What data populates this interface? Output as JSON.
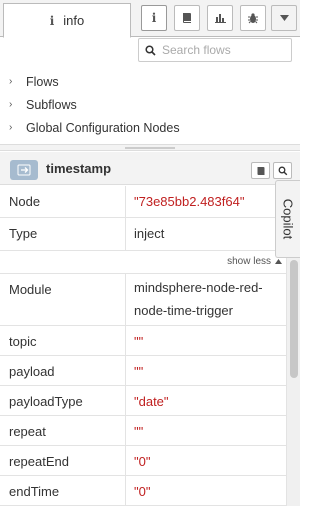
{
  "tabs": {
    "info_label": "info",
    "buttons": [
      "info-icon",
      "book-icon",
      "chart-icon",
      "bug-icon",
      "caret-down-icon"
    ]
  },
  "search": {
    "placeholder": "Search flows"
  },
  "tree": {
    "items": [
      {
        "label": "Flows"
      },
      {
        "label": "Subflows"
      },
      {
        "label": "Global Configuration Nodes"
      }
    ]
  },
  "node": {
    "title": "timestamp",
    "icon": "arrow-right-icon"
  },
  "properties": {
    "node": {
      "key": "Node",
      "value": "\"73e85bb2.483f64\""
    },
    "type": {
      "key": "Type",
      "value": "inject"
    },
    "show_less": "show less",
    "module": {
      "key": "Module",
      "value_line1": "mindsphere-node-red-",
      "value_line2": "node-time-trigger"
    },
    "topic": {
      "key": "topic",
      "value": "\"\""
    },
    "payload": {
      "key": "payload",
      "value": "\"\""
    },
    "payloadType": {
      "key": "payloadType",
      "value": "\"date\""
    },
    "repeat": {
      "key": "repeat",
      "value": "\"\""
    },
    "repeatEnd": {
      "key": "repeatEnd",
      "value": "\"0\""
    },
    "endTime": {
      "key": "endTime",
      "value": "\"0\""
    }
  },
  "copilot": {
    "label": "Copilot"
  },
  "colors": {
    "string_value": "#c02020",
    "node_icon_bg": "#a6bbcf",
    "panel_bg": "#f3f3f3"
  }
}
